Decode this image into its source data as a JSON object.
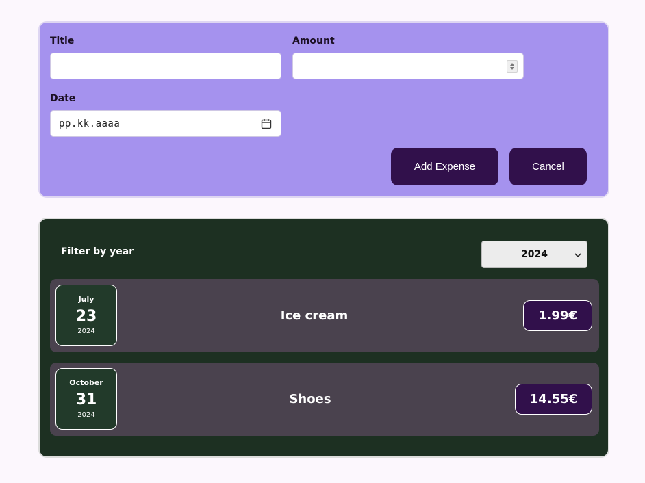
{
  "form": {
    "title_label": "Title",
    "title_value": "",
    "amount_label": "Amount",
    "amount_value": "",
    "date_label": "Date",
    "date_placeholder": "pp.kk.aaaa",
    "add_button": "Add Expense",
    "cancel_button": "Cancel"
  },
  "filter": {
    "label": "Filter by year",
    "selected_year": "2024"
  },
  "expenses": [
    {
      "month": "July",
      "day": "23",
      "year": "2024",
      "title": "Ice cream",
      "amount": "1.99€"
    },
    {
      "month": "October",
      "day": "31",
      "year": "2024",
      "title": "Shoes",
      "amount": "14.55€"
    }
  ],
  "colors": {
    "form_bg": "#a592ee",
    "button_bg": "#31104b",
    "list_bg": "#1d3022",
    "item_bg": "#4a424e",
    "page_bg": "#fcf7fd"
  },
  "icons": {
    "date_field": "calendar-icon",
    "amount_field": "spinner-arrows-icon",
    "year_select": "chevron-down-icon"
  }
}
